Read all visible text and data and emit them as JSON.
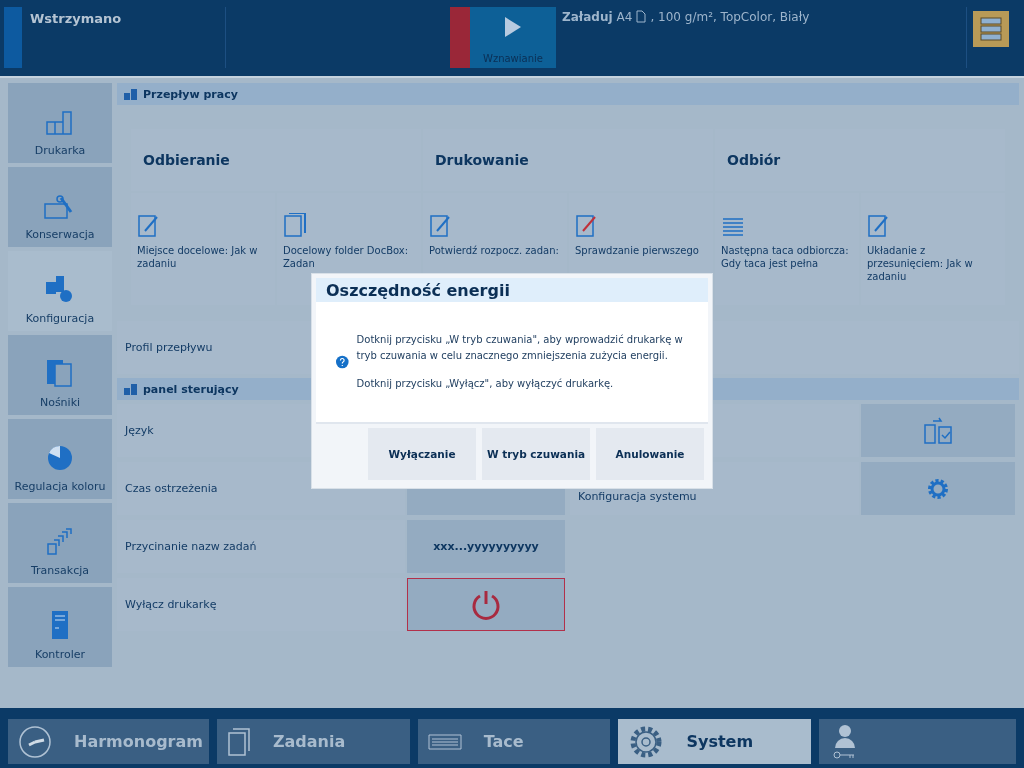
{
  "header": {
    "status": "Wstrzymano",
    "resume_button": "Wznawianie",
    "load": {
      "label": "Załaduj",
      "size": "A4",
      "details": ", 100 g/m², TopColor, Biały"
    }
  },
  "sidebar": {
    "items": [
      {
        "label": "Drukarka",
        "selected": false
      },
      {
        "label": "Konserwacja",
        "selected": false
      },
      {
        "label": "Konfiguracja",
        "selected": true
      },
      {
        "label": "Nośniki",
        "selected": false
      },
      {
        "label": "Regulacja koloru",
        "selected": false
      },
      {
        "label": "Transakcja",
        "selected": false
      },
      {
        "label": "Kontroler",
        "selected": false
      }
    ]
  },
  "workflow": {
    "title": "Przepływ pracy",
    "stages": [
      {
        "title": "Odbieranie",
        "tiles": [
          "Miejsce docelowe: Jak w zadaniu",
          "Docelowy folder DocBox: Zadan"
        ]
      },
      {
        "title": "Drukowanie",
        "tiles": [
          "Potwierdź rozpocz. zadan:",
          "Sprawdzanie pierwszego"
        ]
      },
      {
        "title": "Odbiór",
        "tiles": [
          "Następna taca odbiorcza: Gdy taca jest pełna",
          "Układanie z przesunięciem: Jak w zadaniu"
        ]
      }
    ],
    "profile_label": "Profil przepływu"
  },
  "control_panel": {
    "title": "panel sterujący",
    "rows": [
      {
        "label": "Język",
        "kind": "covered"
      },
      {
        "label": "Czas ostrzeżenia"
      },
      {
        "label": "Przycinanie nazw zadań",
        "value": "xxx...yyyyyyyyyy"
      },
      {
        "label": "Wyłącz drukarkę",
        "kind": "power"
      }
    ],
    "right_rows": [
      {
        "kind": "docs"
      },
      {
        "label": "Konfiguracja systemu",
        "kind": "gear"
      }
    ]
  },
  "dialog": {
    "title": "Oszczędność energii",
    "paragraphs": [
      "Dotknij przycisku „W tryb czuwania\", aby wprowadzić drukarkę w tryb czuwania w celu znacznego zmniejszenia zużycia energii.",
      "Dotknij przycisku „Wyłącz\", aby wyłączyć drukarkę."
    ],
    "buttons": [
      "Wyłączanie",
      "W tryb czuwania",
      "Anulowanie"
    ]
  },
  "bottom_tabs": [
    {
      "label": "Harmonogram",
      "selected": false
    },
    {
      "label": "Zadania",
      "selected": false
    },
    {
      "label": "Tace",
      "selected": false
    },
    {
      "label": "System",
      "selected": true
    }
  ]
}
